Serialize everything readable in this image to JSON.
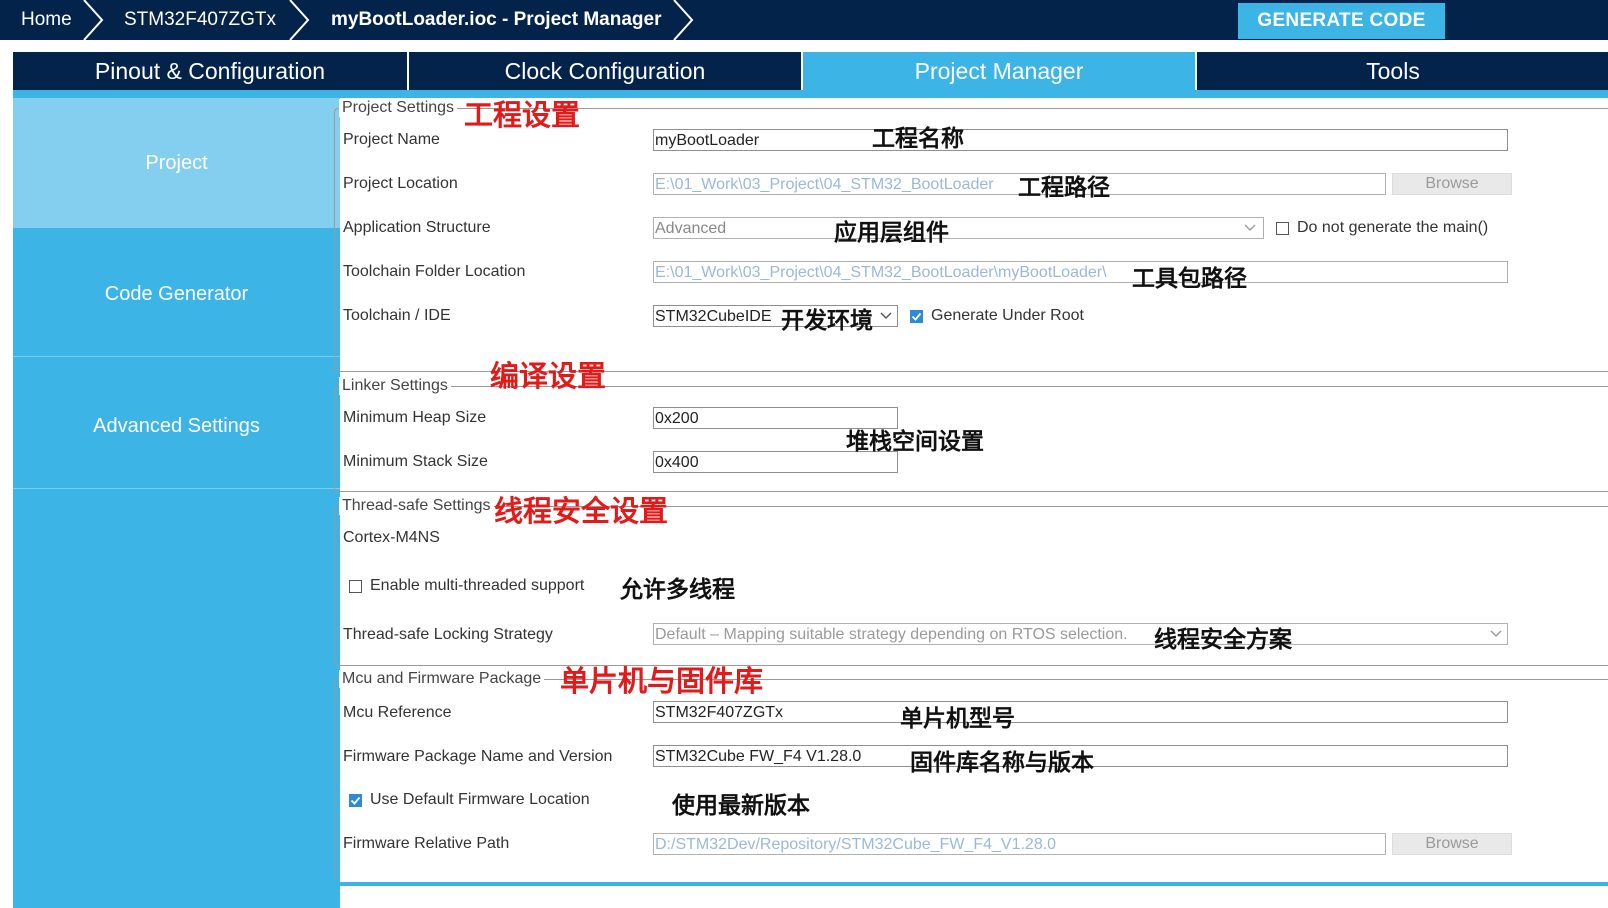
{
  "breadcrumb": {
    "home": "Home",
    "mcu": "STM32F407ZGTx",
    "file": "myBootLoader.ioc - Project Manager"
  },
  "toolbar": {
    "generate": "GENERATE CODE"
  },
  "tabs": [
    {
      "label": "Pinout & Configuration"
    },
    {
      "label": "Clock Configuration"
    },
    {
      "label": "Project Manager"
    },
    {
      "label": "Tools"
    }
  ],
  "sidebar": {
    "items": [
      {
        "label": "Project"
      },
      {
        "label": "Code Generator"
      },
      {
        "label": "Advanced Settings"
      }
    ]
  },
  "project_settings": {
    "legend": "Project Settings",
    "name_label": "Project Name",
    "name_value": "myBootLoader",
    "location_label": "Project Location",
    "location_value": "E:\\01_Work\\03_Project\\04_STM32_BootLoader",
    "browse": "Browse",
    "app_structure_label": "Application Structure",
    "app_structure_value": "Advanced",
    "no_main_label": "Do not generate the main()",
    "toolchain_folder_label": "Toolchain Folder Location",
    "toolchain_folder_value": "E:\\01_Work\\03_Project\\04_STM32_BootLoader\\myBootLoader\\",
    "toolchain_label": "Toolchain / IDE",
    "toolchain_value": "STM32CubeIDE",
    "gen_under_root_label": "Generate Under Root"
  },
  "linker_settings": {
    "legend": "Linker Settings",
    "heap_label": "Minimum Heap Size",
    "heap_value": "0x200",
    "stack_label": "Minimum Stack Size",
    "stack_value": "0x400"
  },
  "thread_safe": {
    "legend": "Thread-safe Settings",
    "core": "Cortex-M4NS",
    "multi_thread_label": "Enable multi-threaded support",
    "locking_label": "Thread-safe Locking Strategy",
    "locking_value": "Default  –  Mapping suitable strategy depending on RTOS selection."
  },
  "mcu_fw": {
    "legend": "Mcu and Firmware Package",
    "mcu_ref_label": "Mcu Reference",
    "mcu_ref_value": "STM32F407ZGTx",
    "fw_label": "Firmware Package Name and Version",
    "fw_value": "STM32Cube FW_F4 V1.28.0",
    "use_default_label": "Use Default Firmware Location",
    "path_label": "Firmware Relative Path",
    "path_value": "D:/STM32Dev/Repository/STM32Cube_FW_F4_V1.28.0",
    "browse": "Browse"
  },
  "annotations": {
    "project_settings": "工程设置",
    "project_name": "工程名称",
    "project_path": "工程路径",
    "app_components": "应用层组件",
    "toolkit_path": "工具包路径",
    "dev_env": "开发环境",
    "compile_settings": "编译设置",
    "heap_stack": "堆栈空间设置",
    "thread_safe": "线程安全设置",
    "allow_multi": "允许多线程",
    "thread_scheme": "线程安全方案",
    "mcu_fw": "单片机与固件库",
    "mcu_model": "单片机型号",
    "fw_name_ver": "固件库名称与版本",
    "use_latest": "使用最新版本"
  },
  "colors": {
    "navy": "#03234b",
    "accent": "#3cb4e6",
    "annotation_red": "#e21a1a"
  }
}
